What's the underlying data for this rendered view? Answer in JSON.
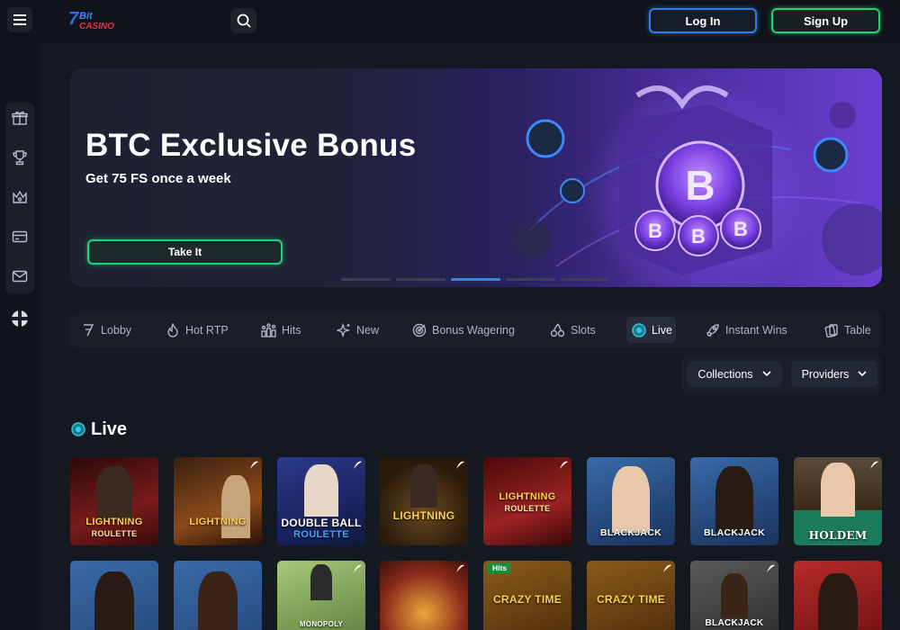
{
  "header": {
    "login_label": "Log In",
    "signup_label": "Sign Up",
    "logo_text": "7Bit CASINO"
  },
  "sidebar": {
    "items": [
      {
        "icon": "gift-icon"
      },
      {
        "icon": "trophy-icon"
      },
      {
        "icon": "crown-icon"
      },
      {
        "icon": "card-icon"
      },
      {
        "icon": "mail-icon"
      }
    ],
    "extra_icon": "uk-flag-icon"
  },
  "banner": {
    "title": "BTC Exclusive Bonus",
    "subtitle": "Get 75 FS once a week",
    "cta_label": "Take It",
    "slides_total": 5,
    "active_slide": 3
  },
  "categories": [
    {
      "label": "Lobby",
      "icon": "lobby-icon"
    },
    {
      "label": "Hot RTP",
      "icon": "flame-icon"
    },
    {
      "label": "Hits",
      "icon": "hits-icon"
    },
    {
      "label": "New",
      "icon": "sparkle-icon"
    },
    {
      "label": "Bonus Wagering",
      "icon": "target-icon"
    },
    {
      "label": "Slots",
      "icon": "cherries-icon"
    },
    {
      "label": "Live",
      "icon": "live-icon",
      "active": true
    },
    {
      "label": "Instant Wins",
      "icon": "rocket-icon"
    },
    {
      "label": "Table",
      "icon": "cards-icon"
    }
  ],
  "filters": {
    "collections_label": "Collections",
    "providers_label": "Providers"
  },
  "section": {
    "title": "Live"
  },
  "games_row1": [
    {
      "label": "LIGHTNING",
      "sub": "ROULETTE",
      "bg": "#5a1414"
    },
    {
      "label": "LIGHTNING",
      "sub": "",
      "bg": "#4a2010"
    },
    {
      "label": "DOUBLE BALL",
      "sub": "ROULETTE",
      "bg": "#1e2d6a"
    },
    {
      "label": "LIGHTNING",
      "sub": "",
      "bg": "#3a2410"
    },
    {
      "label": "LIGHTNING",
      "sub": "ROULETTE",
      "bg": "#6a1a1a"
    },
    {
      "label": "BLACKJACK",
      "sub": "",
      "bg": "#2a4a7a"
    },
    {
      "label": "BLACKJACK",
      "sub": "",
      "bg": "#2a4a7a"
    },
    {
      "label": "HOLDEM",
      "sub": "",
      "bg": "#1a6a4a"
    }
  ],
  "games_row2": [
    {
      "label": "",
      "badge": "",
      "bg": "#2a4a7a"
    },
    {
      "label": "",
      "badge": "",
      "bg": "#2a4a7a"
    },
    {
      "label": "MONOPOLY",
      "badge": "",
      "bg": "#5a7a3a"
    },
    {
      "label": "",
      "badge": "",
      "bg": "#6a2a1a"
    },
    {
      "label": "CRAZY TIME",
      "badge": "Hits",
      "bg": "#6a4a1a"
    },
    {
      "label": "CRAZY TIME",
      "badge": "",
      "bg": "#6a4a1a"
    },
    {
      "label": "BLACKJACK",
      "badge": "",
      "bg": "#3a3a3a"
    },
    {
      "label": "",
      "badge": "",
      "bg": "#8a1a1a"
    }
  ]
}
